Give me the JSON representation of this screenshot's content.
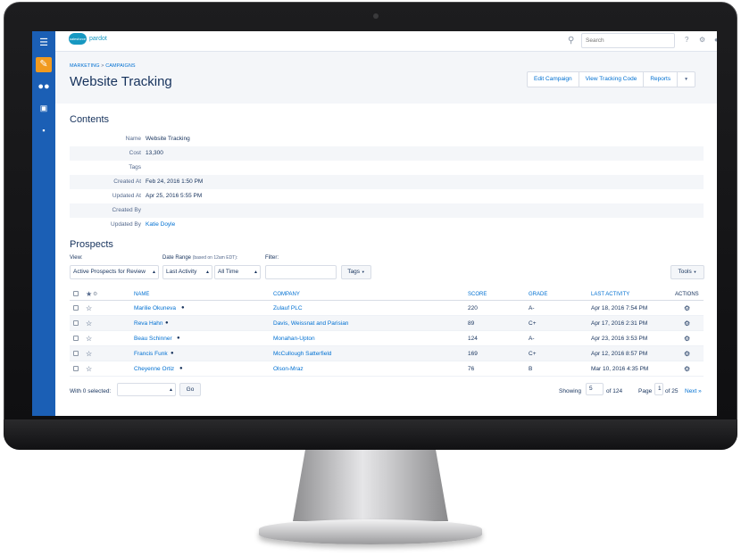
{
  "topbar": {
    "logo_text": "pardot",
    "logo_mark": "salesforce",
    "search_placeholder": "Search",
    "help_glyph": "?",
    "icons": [
      "search-icon",
      "help-icon",
      "gear-icon",
      "user-icon"
    ]
  },
  "rail": {
    "icons": [
      "menu-icon",
      "pencil-icon",
      "users-icon",
      "chart-icon",
      "briefcase-icon"
    ]
  },
  "header": {
    "breadcrumb": [
      "MARKETING",
      "CAMPAIGNS"
    ],
    "breadcrumb_sep": ">",
    "title": "Website Tracking",
    "buttons": [
      "Edit Campaign",
      "View Tracking Code",
      "Reports"
    ]
  },
  "contents": {
    "title": "Contents",
    "fields": [
      {
        "label": "Name",
        "value": "Website Tracking"
      },
      {
        "label": "Cost",
        "value": "13,300"
      },
      {
        "label": "Tags",
        "value": ""
      },
      {
        "label": "Created At",
        "value": "Feb 24, 2016 1:50 PM"
      },
      {
        "label": "Updated At",
        "value": "Apr 25, 2016 5:55 PM"
      },
      {
        "label": "Created By",
        "value": ""
      },
      {
        "label": "Updated By",
        "value": "Katie Doyle"
      }
    ]
  },
  "prospects": {
    "title": "Prospects",
    "filters": {
      "view_label": "View:",
      "view_value": "Active Prospects for Review",
      "date_label": "Date Range",
      "date_note": "(based on 12am EDT):",
      "date_field": "Last Activity",
      "date_range": "All Time",
      "filter_label": "Filter:",
      "filter_value": "",
      "tags_button": "Tags",
      "tools_button": "Tools"
    },
    "columns": [
      "NAME",
      "COMPANY",
      "SCORE",
      "GRADE",
      "LAST ACTIVITY",
      "ACTIONS"
    ],
    "rows": [
      {
        "name": "Marilie Okuneva",
        "company": "Zulauf PLC",
        "score": "220",
        "grade": "A-",
        "last_activity": "Apr 18, 2016 7:54 PM"
      },
      {
        "name": "Reva Hahn",
        "company": "Davis, Weissnat and Parisian",
        "score": "89",
        "grade": "C+",
        "last_activity": "Apr 17, 2016 2:31 PM"
      },
      {
        "name": "Beau Schinner",
        "company": "Monahan-Upton",
        "score": "124",
        "grade": "A-",
        "last_activity": "Apr 23, 2016 3:53 PM"
      },
      {
        "name": "Francis Funk",
        "company": "McCullough Satterfield",
        "score": "169",
        "grade": "C+",
        "last_activity": "Apr 12, 2016 8:57 PM"
      },
      {
        "name": "Cheyenne Ortiz",
        "company": "Olson-Mraz",
        "score": "76",
        "grade": "B",
        "last_activity": "Mar 10, 2016 4:35 PM"
      }
    ],
    "footer": {
      "with_selected": "With 0 selected:",
      "go_button": "Go",
      "showing_label": "Showing",
      "showing_value": "5",
      "of_total": "of 124",
      "page_label": "Page",
      "page_value": "1",
      "of_pages": "of 25",
      "next": "Next »"
    }
  }
}
